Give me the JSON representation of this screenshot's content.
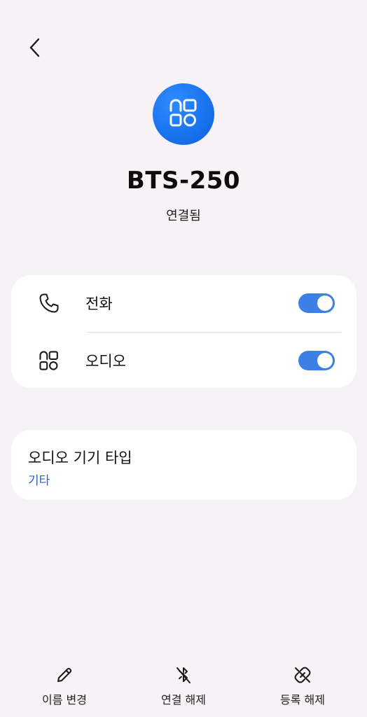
{
  "header": {
    "back_icon": "chevron-left-icon"
  },
  "device": {
    "icon": "device-category-icon",
    "accent_color": "#1a74f0",
    "name": "BTS-250",
    "status": "연결됨"
  },
  "profiles": {
    "items": [
      {
        "icon": "phone-icon",
        "label": "전화",
        "enabled": true
      },
      {
        "icon": "audio-device-icon",
        "label": "오디오",
        "enabled": true
      }
    ],
    "toggle_color": "#3c7fe6"
  },
  "audio_type": {
    "title": "오디오 기기 타입",
    "value": "기타",
    "value_color": "#2d64c8"
  },
  "bottom_bar": {
    "rename": {
      "icon": "pencil-icon",
      "label": "이름 변경"
    },
    "disconnect": {
      "icon": "bluetooth-off-icon",
      "label": "연결 해제"
    },
    "unpair": {
      "icon": "unlink-icon",
      "label": "등록 해제"
    }
  }
}
